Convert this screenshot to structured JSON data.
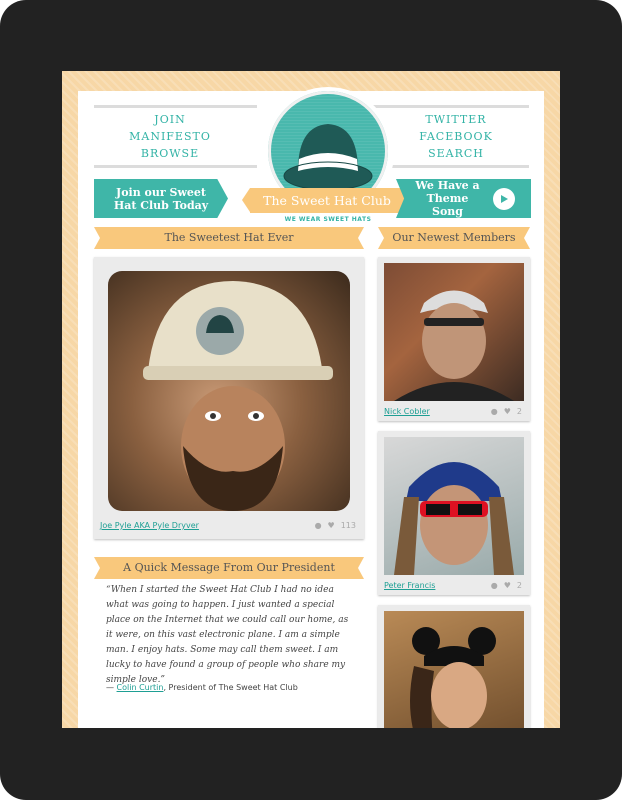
{
  "nav_left": [
    "JOIN",
    "MANIFESTO",
    "BROWSE"
  ],
  "nav_right": [
    "TWITTER",
    "FACEBOOK",
    "SEARCH"
  ],
  "logo": {
    "name": "The Sweet Hat Club",
    "tagline": "WE WEAR SWEET HATS"
  },
  "cta": {
    "join": "Join our Sweet Hat Club Today",
    "song": "We Have a Theme Song"
  },
  "featured": {
    "heading": "The Sweetest Hat Ever",
    "caption": "Joe Pyle AKA Pyle Dryver",
    "likes": "113"
  },
  "members": {
    "heading": "Our Newest Members",
    "items": [
      {
        "name": "Nick Cobler",
        "likes": "2"
      },
      {
        "name": "Peter Francis",
        "likes": "2"
      },
      {
        "name": "",
        "likes": ""
      }
    ]
  },
  "message": {
    "heading": "A Quick Message From Our President",
    "quote": "“When I started the Sweet Hat Club I had no idea what was going to happen. I just wanted a special place on the Internet that we could call our home, as it were, on this vast electronic plane. I am a simple man. I enjoy hats. Some may call them sweet. I am lucky to have found a group of people who share my simple love.”",
    "attribution_dash": "—",
    "author": "Colin Curtin",
    "author_title": ", President of The Sweet Hat Club"
  },
  "colors": {
    "teal": "#3fb6a8",
    "ribbon": "#f9c87c",
    "background": "#f7d7a6"
  },
  "icons": [
    "bowler-hat-icon",
    "play-icon",
    "comment-icon",
    "heart-icon"
  ]
}
